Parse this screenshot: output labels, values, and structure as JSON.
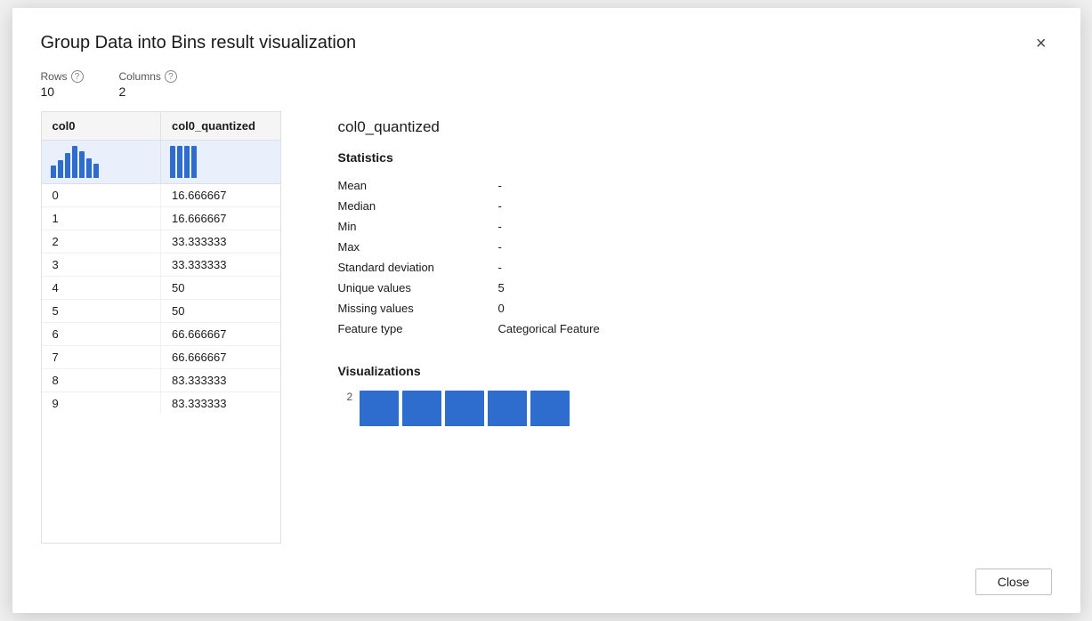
{
  "dialog": {
    "title": "Group Data into Bins result visualization",
    "close_label": "×"
  },
  "meta": {
    "rows_label": "Rows",
    "rows_value": "10",
    "cols_label": "Columns",
    "cols_value": "2"
  },
  "table": {
    "headers": [
      "col0",
      "col0_quantized"
    ],
    "rows": [
      [
        "0",
        "16.666667"
      ],
      [
        "1",
        "16.666667"
      ],
      [
        "2",
        "33.333333"
      ],
      [
        "3",
        "33.333333"
      ],
      [
        "4",
        "50"
      ],
      [
        "5",
        "50"
      ],
      [
        "6",
        "66.666667"
      ],
      [
        "7",
        "66.666667"
      ],
      [
        "8",
        "83.333333"
      ],
      [
        "9",
        "83.333333"
      ]
    ]
  },
  "stats_panel": {
    "col_title": "col0_quantized",
    "statistics_section": "Statistics",
    "stats": [
      {
        "label": "Mean",
        "value": "-"
      },
      {
        "label": "Median",
        "value": "-"
      },
      {
        "label": "Min",
        "value": "-"
      },
      {
        "label": "Max",
        "value": "-"
      },
      {
        "label": "Standard deviation",
        "value": "-"
      },
      {
        "label": "Unique values",
        "value": "5"
      },
      {
        "label": "Missing values",
        "value": "0"
      },
      {
        "label": "Feature type",
        "value": "Categorical Feature"
      }
    ],
    "visualizations_section": "Visualizations",
    "chart_top_label": "2",
    "chart_bars": [
      2,
      2,
      2,
      2,
      2
    ]
  },
  "footer": {
    "close_label": "Close"
  }
}
